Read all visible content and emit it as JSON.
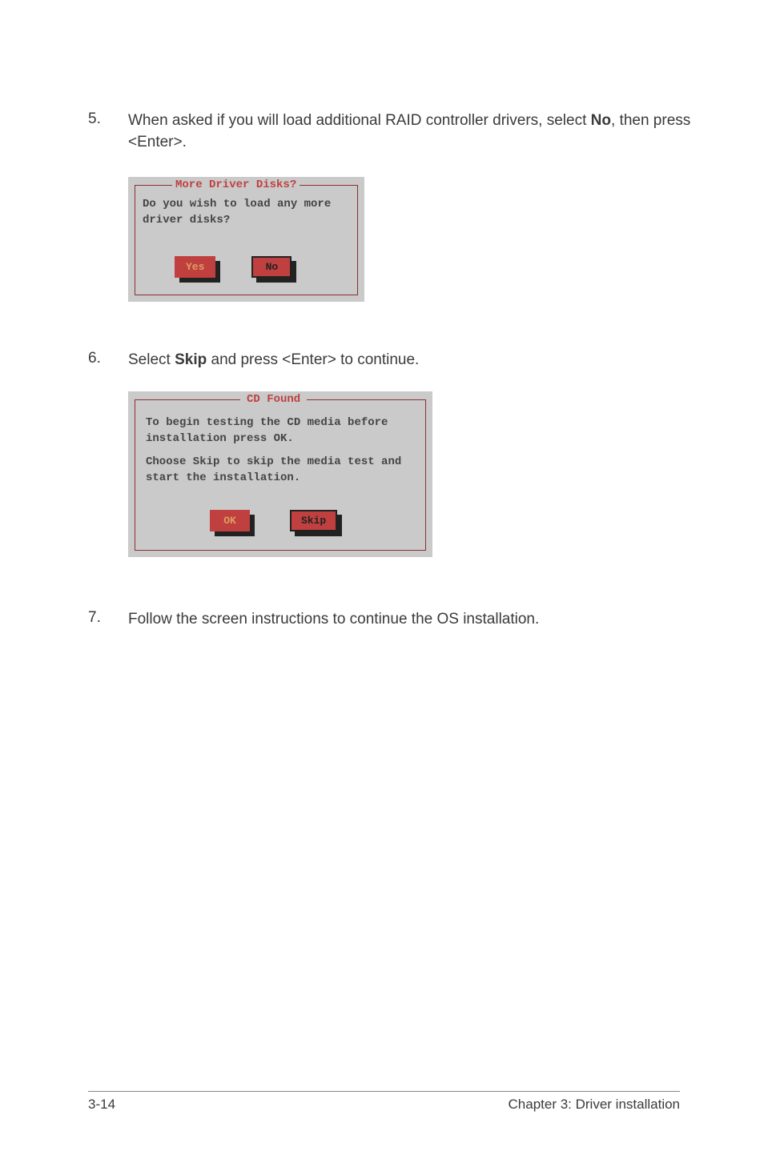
{
  "step5": {
    "num": "5.",
    "text_before": "When asked if you will load additional RAID controller drivers, select ",
    "text_bold": "No",
    "text_after": ", then press <Enter>."
  },
  "dialog1": {
    "title": "More Driver Disks?",
    "text": "Do you wish to load any more driver disks?",
    "yes": "Yes",
    "no": "No"
  },
  "step6": {
    "num": "6.",
    "text_before": "Select ",
    "text_bold": "Skip",
    "text_after": " and press <Enter> to continue."
  },
  "dialog2": {
    "title": "CD Found",
    "text1": "To begin testing the CD media before installation press OK.",
    "text2": "Choose Skip to skip the media test and start the installation.",
    "ok": "OK",
    "skip": "Skip"
  },
  "step7": {
    "num": "7.",
    "text": "Follow the screen instructions to continue the OS installation."
  },
  "footer": {
    "page": "3-14",
    "chapter": "Chapter 3: Driver installation"
  }
}
